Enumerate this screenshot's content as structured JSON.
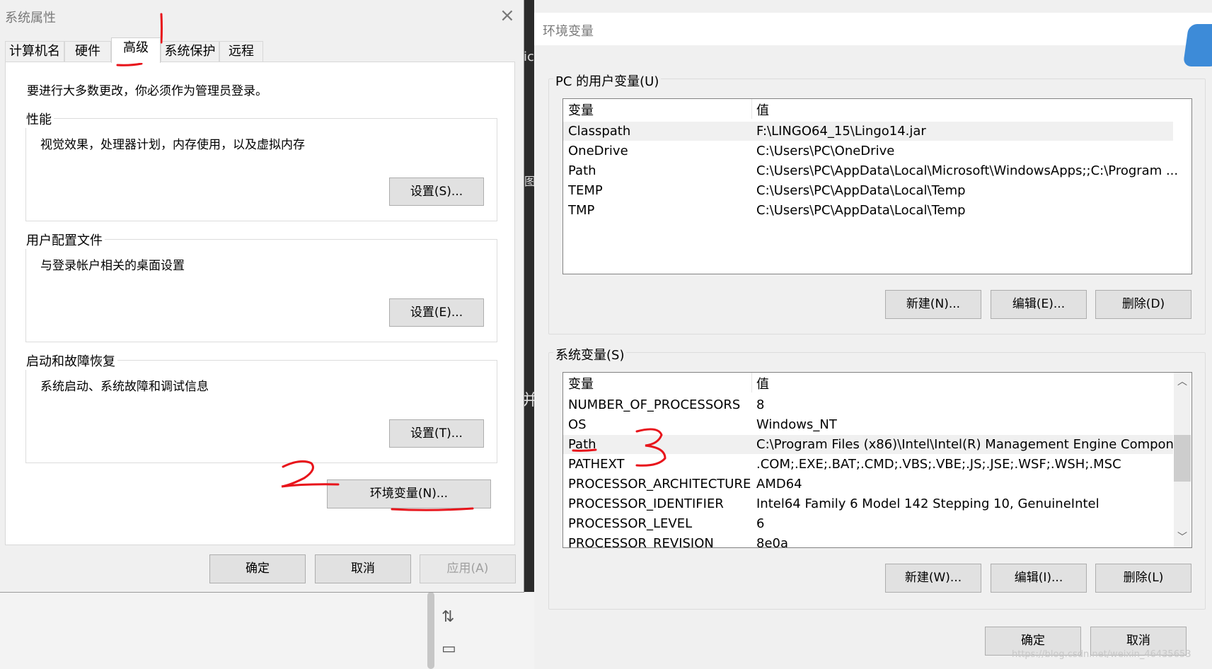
{
  "system_properties": {
    "title": "系统属性",
    "tabs": [
      {
        "label": "计算机名"
      },
      {
        "label": "硬件"
      },
      {
        "label": "高级"
      },
      {
        "label": "系统保护"
      },
      {
        "label": "远程"
      }
    ],
    "admin_notice": "要进行大多数更改，你必须作为管理员登录。",
    "performance": {
      "title": "性能",
      "description": "视觉效果，处理器计划，内存使用，以及虚拟内存",
      "button": "设置(S)..."
    },
    "user_profiles": {
      "title": "用户配置文件",
      "description": "与登录帐户相关的桌面设置",
      "button": "设置(E)..."
    },
    "startup_recovery": {
      "title": "启动和故障恢复",
      "description": "系统启动、系统故障和调试信息",
      "button": "设置(T)..."
    },
    "env_button": "环境变量(N)...",
    "ok": "确定",
    "cancel": "取消",
    "apply": "应用(A)"
  },
  "environment_variables": {
    "title": "环境变量",
    "user_vars": {
      "group_label": "PC 的用户变量(U)",
      "col_var": "变量",
      "col_val": "值",
      "rows": [
        {
          "name": "Classpath",
          "value": "F:\\LINGO64_15\\Lingo14.jar"
        },
        {
          "name": "OneDrive",
          "value": "C:\\Users\\PC\\OneDrive"
        },
        {
          "name": "Path",
          "value": "C:\\Users\\PC\\AppData\\Local\\Microsoft\\WindowsApps;;C:\\Program ..."
        },
        {
          "name": "TEMP",
          "value": "C:\\Users\\PC\\AppData\\Local\\Temp"
        },
        {
          "name": "TMP",
          "value": "C:\\Users\\PC\\AppData\\Local\\Temp"
        }
      ],
      "new": "新建(N)...",
      "edit": "编辑(E)...",
      "delete": "删除(D)"
    },
    "system_vars": {
      "group_label": "系统变量(S)",
      "col_var": "变量",
      "col_val": "值",
      "rows": [
        {
          "name": "NUMBER_OF_PROCESSORS",
          "value": "8"
        },
        {
          "name": "OS",
          "value": "Windows_NT"
        },
        {
          "name": "Path",
          "value": "C:\\Program Files (x86)\\Intel\\Intel(R) Management Engine Compon..."
        },
        {
          "name": "PATHEXT",
          "value": ".COM;.EXE;.BAT;.CMD;.VBS;.VBE;.JS;.JSE;.WSF;.WSH;.MSC"
        },
        {
          "name": "PROCESSOR_ARCHITECTURE",
          "value": "AMD64"
        },
        {
          "name": "PROCESSOR_IDENTIFIER",
          "value": "Intel64 Family 6 Model 142 Stepping 10, GenuineIntel"
        },
        {
          "name": "PROCESSOR_LEVEL",
          "value": "6"
        },
        {
          "name": "PROCESSOR_REVISION",
          "value": "8e0a"
        }
      ],
      "new": "新建(W)...",
      "edit": "编辑(I)...",
      "delete": "删除(L)"
    },
    "ok": "确定",
    "cancel": "取消"
  },
  "background_fragments": {
    "text1": "ic",
    "text2": "图",
    "text3": "并"
  },
  "watermark": "https://blog.csdn.net/weixin_46435653",
  "annotations": [
    "1",
    "2",
    "3"
  ],
  "colors": {
    "annotation_red": "#e8141b",
    "selection": "#f0f0f0",
    "dialog_bg": "#f0f0f0",
    "button_bg": "#e1e1e1"
  }
}
